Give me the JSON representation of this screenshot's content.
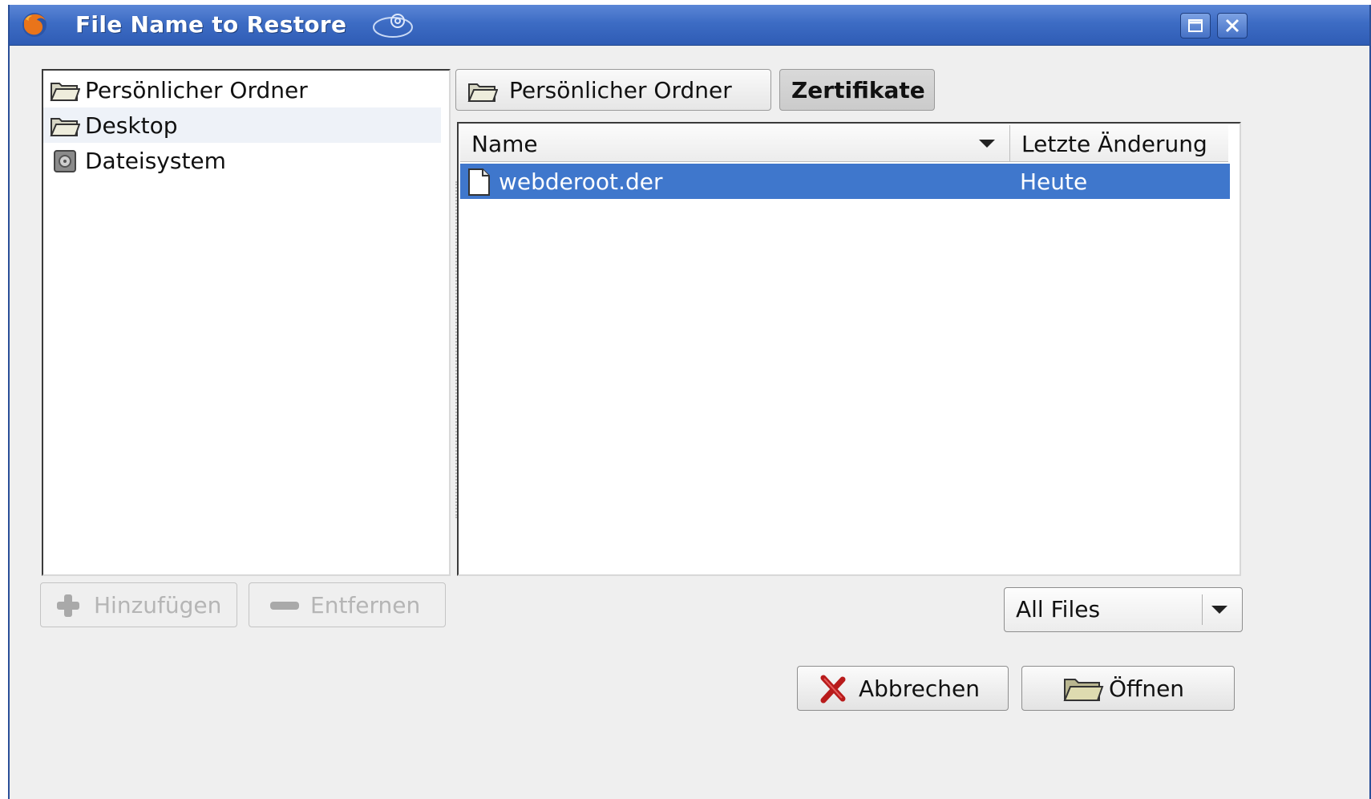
{
  "window": {
    "title": "File Name to Restore"
  },
  "places": {
    "items": [
      {
        "label": "Persönlicher Ordner",
        "icon": "folder-icon"
      },
      {
        "label": "Desktop",
        "icon": "folder-icon"
      },
      {
        "label": "Dateisystem",
        "icon": "drive-icon"
      }
    ],
    "add_label": "Hinzufügen",
    "remove_label": "Entfernen"
  },
  "path_bar": {
    "buttons": [
      {
        "label": "Persönlicher Ordner"
      },
      {
        "label": "Zertifikate"
      }
    ]
  },
  "file_list": {
    "columns": [
      "Name",
      "Letzte Änderung"
    ],
    "rows": [
      {
        "name": "webderoot.der",
        "modified": "Heute"
      }
    ]
  },
  "filter": {
    "selected": "All Files"
  },
  "actions": {
    "cancel_label": "Abbrechen",
    "open_label": "Öffnen"
  },
  "colors": {
    "title_bar": "#3d6cc4",
    "selection": "#3f77cc"
  }
}
